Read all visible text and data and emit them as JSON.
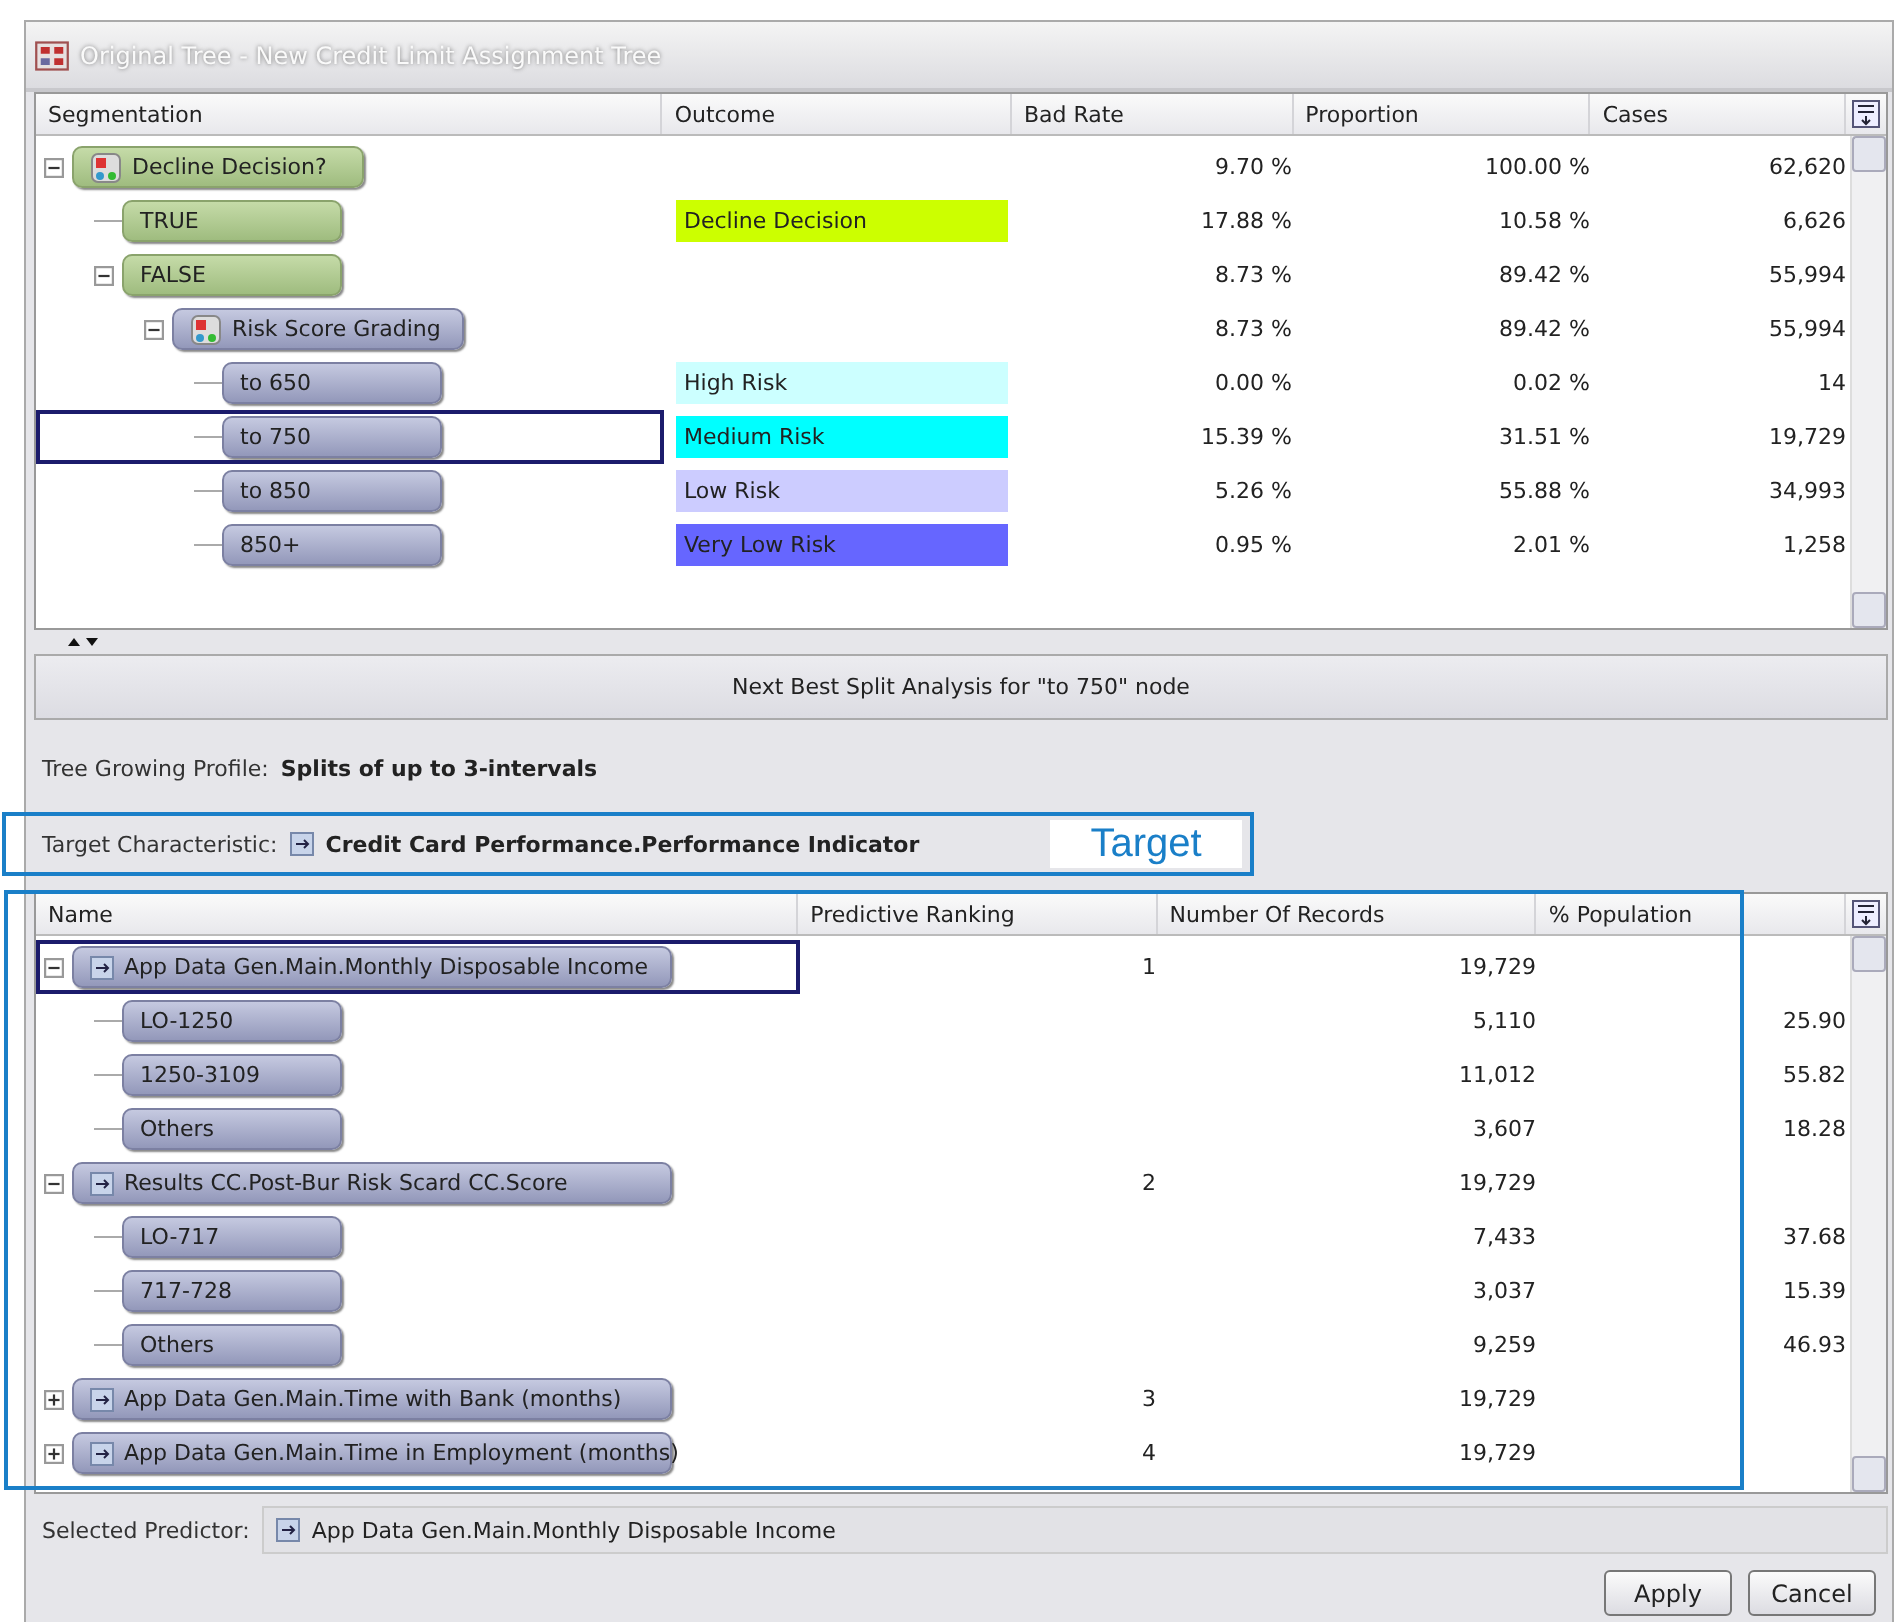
{
  "window": {
    "title": "Original Tree - New Credit Limit Assignment Tree"
  },
  "top_table": {
    "columns": [
      "Segmentation",
      "Outcome",
      "Bad Rate",
      "Proportion",
      "Cases"
    ],
    "rows": [
      {
        "label": "Decline Decision?",
        "kind": "decision",
        "expanded": true,
        "selected": false,
        "bad_rate": "9.70 %",
        "proportion": "100.00 %",
        "cases": "62,620",
        "children": [
          {
            "label": "TRUE",
            "kind": "leaf",
            "selected": false,
            "outcome": {
              "text": "Decline Decision",
              "color": "#ccff00"
            },
            "bad_rate": "17.88 %",
            "proportion": "10.58 %",
            "cases": "6,626"
          },
          {
            "label": "FALSE",
            "kind": "leaf",
            "expanded": true,
            "selected": false,
            "bad_rate": "8.73 %",
            "proportion": "89.42 %",
            "cases": "55,994",
            "children": [
              {
                "label": "Risk Score Grading",
                "kind": "split",
                "expanded": true,
                "selected": false,
                "bad_rate": "8.73 %",
                "proportion": "89.42 %",
                "cases": "55,994",
                "children": [
                  {
                    "label": "to 650",
                    "kind": "bin",
                    "selected": false,
                    "outcome": {
                      "text": "High Risk",
                      "color": "#ccffff"
                    },
                    "bad_rate": "0.00 %",
                    "proportion": "0.02 %",
                    "cases": "14"
                  },
                  {
                    "label": "to 750",
                    "kind": "bin",
                    "selected": true,
                    "outcome": {
                      "text": "Medium Risk",
                      "color": "#00ffff"
                    },
                    "bad_rate": "15.39 %",
                    "proportion": "31.51 %",
                    "cases": "19,729"
                  },
                  {
                    "label": "to 850",
                    "kind": "bin",
                    "selected": false,
                    "outcome": {
                      "text": "Low Risk",
                      "color": "#ccccff"
                    },
                    "bad_rate": "5.26 %",
                    "proportion": "55.88 %",
                    "cases": "34,993"
                  },
                  {
                    "label": "850+",
                    "kind": "bin",
                    "selected": false,
                    "outcome": {
                      "text": "Very Low Risk",
                      "color": "#6666ff"
                    },
                    "bad_rate": "0.95 %",
                    "proportion": "2.01 %",
                    "cases": "1,258"
                  }
                ]
              }
            ]
          }
        ]
      }
    ]
  },
  "split_button": "Next Best Split Analysis for \"to 750\" node",
  "profile": {
    "label": "Tree Growing Profile:",
    "value": "Splits of up to 3-intervals"
  },
  "target": {
    "label": "Target Characteristic:",
    "value": "Credit Card Performance.Performance Indicator",
    "callout": "Target"
  },
  "predictor_table": {
    "columns": [
      "Name",
      "Predictive Ranking",
      "Number Of Records",
      "% Population"
    ],
    "rows": [
      {
        "label": "App Data Gen.Main.Monthly Disposable Income",
        "kind": "predictor",
        "expanded": true,
        "selected": true,
        "ranking": "1",
        "records": "19,729",
        "children": [
          {
            "label": "LO-1250",
            "kind": "bin",
            "selected": false,
            "records": "5,110",
            "population": "25.90"
          },
          {
            "label": "1250-3109",
            "kind": "bin",
            "selected": false,
            "records": "11,012",
            "population": "55.82"
          },
          {
            "label": "Others",
            "kind": "bin",
            "selected": false,
            "records": "3,607",
            "population": "18.28"
          }
        ]
      },
      {
        "label": "Results CC.Post-Bur Risk Scard CC.Score",
        "kind": "predictor",
        "expanded": true,
        "selected": false,
        "ranking": "2",
        "records": "19,729",
        "children": [
          {
            "label": "LO-717",
            "kind": "bin",
            "selected": false,
            "records": "7,433",
            "population": "37.68"
          },
          {
            "label": "717-728",
            "kind": "bin",
            "selected": false,
            "records": "3,037",
            "population": "15.39"
          },
          {
            "label": "Others",
            "kind": "bin",
            "selected": false,
            "records": "9,259",
            "population": "46.93"
          }
        ]
      },
      {
        "label": "App Data Gen.Main.Time with Bank (months)",
        "kind": "predictor",
        "expanded": false,
        "selected": false,
        "ranking": "3",
        "records": "19,729"
      },
      {
        "label": "App Data Gen.Main.Time in Employment (months)",
        "kind": "predictor",
        "expanded": false,
        "selected": false,
        "ranking": "4",
        "records": "19,729"
      }
    ]
  },
  "selected_predictor": {
    "label": "Selected Predictor:",
    "value": "App Data Gen.Main.Monthly Disposable Income"
  },
  "buttons": [
    "Apply",
    "Cancel"
  ]
}
